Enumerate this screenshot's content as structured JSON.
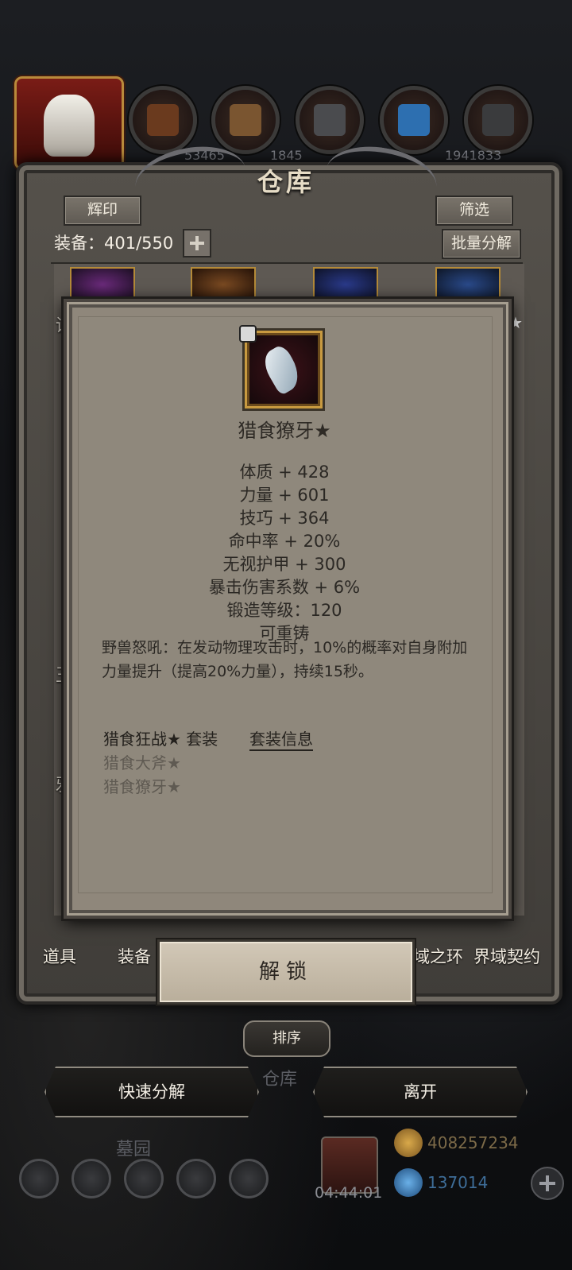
{
  "window": {
    "title": "仓库"
  },
  "top_numbers": [
    "53465",
    "1845",
    "1941833"
  ],
  "header": {
    "emblem_label": "辉印",
    "filter_label": "筛选",
    "equipment_count": "装备：401/550",
    "batch_dismantle_label": "批量分解"
  },
  "side_chars": {
    "a": "诚",
    "b": "剔",
    "c": "王",
    "d": "邪"
  },
  "side_star": "★",
  "item": {
    "name": "猎食獠牙★",
    "stats": [
      "体质 + 428",
      "力量 + 601",
      "技巧 + 364",
      "命中率 + 20%",
      "无视护甲 + 300",
      "暴击伤害系数 + 6%",
      "锻造等级：120",
      "可重铸"
    ],
    "description": "野兽怒吼：在发动物理攻击时，10%的概率对自身附加力量提升（提高20%力量），持续15秒。",
    "set_name": "猎食狂战★ 套装",
    "set_info_label": "套装信息",
    "set_items": [
      "猎食大斧★",
      "猎食獠牙★"
    ]
  },
  "tabs": {
    "props": "道具",
    "equipment": "装备",
    "ring": "域之环",
    "contract": "界域契约"
  },
  "unlock_label": "解锁",
  "sort_label": "排序",
  "behind_labels": {
    "warehouse": "仓库",
    "cemetery": "墓园"
  },
  "buttons": {
    "quick_dismantle": "快速分解",
    "leave": "离开"
  },
  "timer": "04:44:01",
  "currency": {
    "gold": "408257234",
    "gems": "137014"
  },
  "colors": {
    "panel": "#5e5953",
    "modal": "#8f877b",
    "gold_border": "#c89a40"
  }
}
